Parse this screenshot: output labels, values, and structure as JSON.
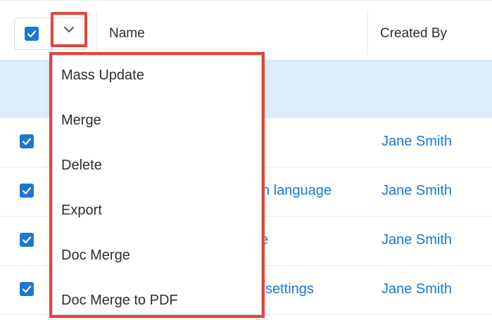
{
  "header": {
    "name_label": "Name",
    "created_by_label": "Created By"
  },
  "menu": {
    "items": [
      {
        "label": "Mass Update"
      },
      {
        "label": "Merge"
      },
      {
        "label": "Delete"
      },
      {
        "label": "Export"
      },
      {
        "label": "Doc Merge"
      },
      {
        "label": "Doc Merge to PDF"
      }
    ]
  },
  "rows": [
    {
      "name_visible": "",
      "created_by": "Jane Smith",
      "checked": true
    },
    {
      "name_visible": "n language",
      "created_by": "Jane Smith",
      "checked": true
    },
    {
      "name_visible": "e",
      "created_by": "Jane Smith",
      "checked": true
    },
    {
      "name_visible": "settings",
      "created_by": "Jane Smith",
      "checked": true
    }
  ],
  "colors": {
    "accent": "#1b77d4",
    "highlight_row": "#ddedfa",
    "callout_border": "#e0463a"
  },
  "icons": {
    "select_all": "checkbox-checked-icon",
    "caret": "chevron-down-icon"
  }
}
